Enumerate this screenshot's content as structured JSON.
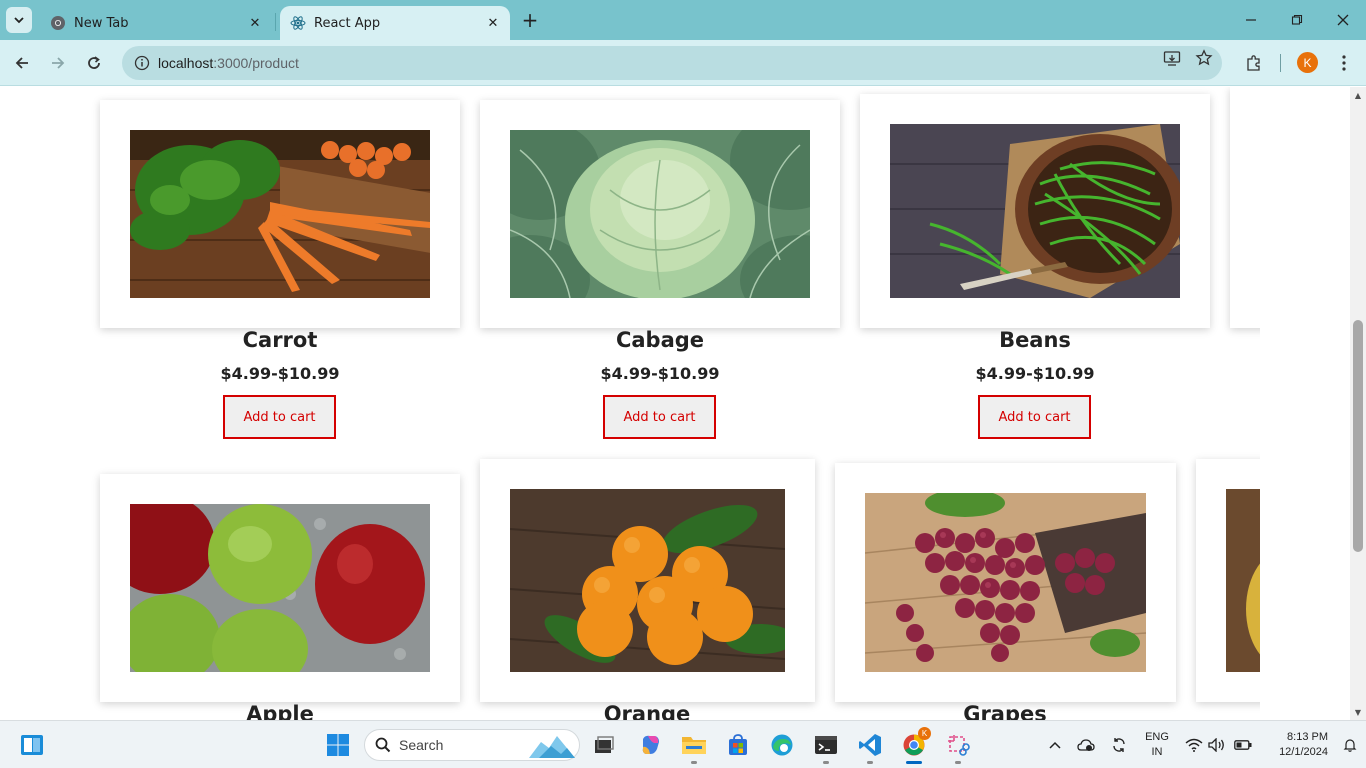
{
  "browser": {
    "tabs": [
      {
        "title": "New Tab",
        "active": false
      },
      {
        "title": "React App",
        "active": true
      }
    ],
    "address": {
      "host": "localhost",
      "path": ":3000/product"
    },
    "profile_initial": "K"
  },
  "products": [
    {
      "name": "Carrot",
      "price": "$4.99-$10.99",
      "button": "Add to cart"
    },
    {
      "name": "Cabage",
      "price": "$4.99-$10.99",
      "button": "Add to cart"
    },
    {
      "name": "Beans",
      "price": "$4.99-$10.99",
      "button": "Add to cart"
    },
    {
      "name": "Apple",
      "price": "",
      "button": ""
    },
    {
      "name": "Orange",
      "price": "",
      "button": ""
    },
    {
      "name": "Grapes",
      "price": "",
      "button": ""
    }
  ],
  "taskbar": {
    "search_label": "Search",
    "lang_primary": "ENG",
    "lang_secondary": "IN",
    "time": "8:13 PM",
    "date": "12/1/2024",
    "profile_badge": "K"
  },
  "colors": {
    "tabbar": "#78c3cc",
    "toolbar": "#d7f0f3",
    "button_accent": "#d40000"
  }
}
